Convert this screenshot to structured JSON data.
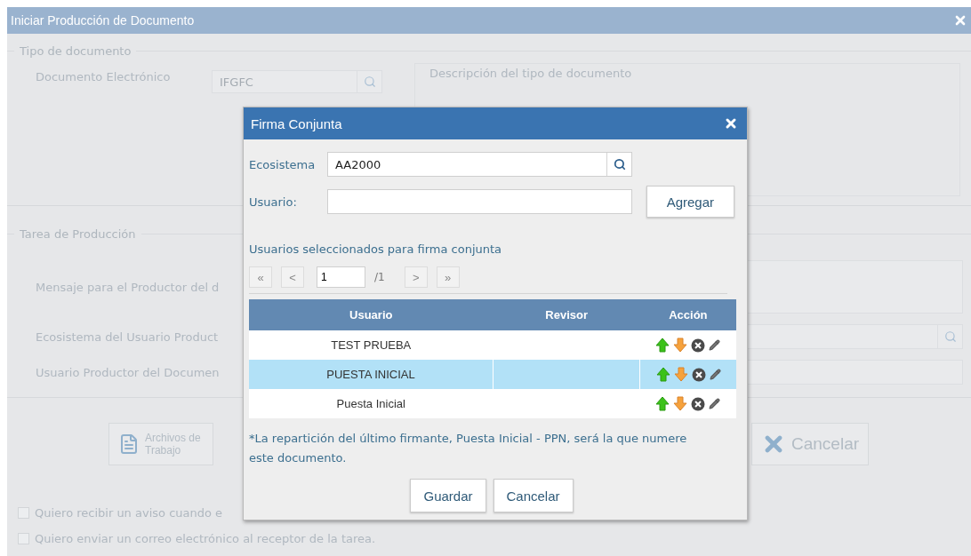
{
  "window": {
    "title": "Iniciar Producción de Documento"
  },
  "document_type": {
    "legend": "Tipo de documento",
    "label": "Documento Electrónico",
    "value": "IFGFC",
    "description_legend": "Descripción del tipo de documento"
  },
  "production_task": {
    "legend": "Tarea de Producción",
    "fields": [
      {
        "label": "Mensaje para el Productor del d",
        "kind": "textarea"
      },
      {
        "label": "Ecosistema del Usuario Product",
        "kind": "search"
      },
      {
        "label": "Usuario Productor del Documen",
        "kind": "text"
      }
    ]
  },
  "actions": [
    {
      "label": "Archivos de Trabajo",
      "kind": "files"
    },
    {
      "label": "Cancelar",
      "kind": "cancel"
    }
  ],
  "options": [
    {
      "label": "Quiero recibir un aviso cuando e",
      "checked": false
    },
    {
      "label": "Quiero enviar un correo electrónico al receptor de la tarea.",
      "checked": false
    }
  ],
  "dialog": {
    "title": "Firma Conjunta",
    "ecosistema_label": "Ecosistema",
    "ecosistema_value": "AA2000",
    "usuario_label": "Usuario:",
    "add_button": "Agregar",
    "list_title": "Usuarios seleccionados para firma conjunta",
    "pager": {
      "first": "«",
      "prev": "<",
      "page": "1",
      "total": "/1",
      "next": ">",
      "last": "»"
    },
    "table": {
      "columns": [
        "Usuario",
        "Revisor",
        "Acción"
      ],
      "rows": [
        {
          "usuario": "TEST PRUEBA",
          "selected": false
        },
        {
          "usuario": "PUESTA INICIAL",
          "selected": true
        },
        {
          "usuario": "Puesta Inicial",
          "selected": false
        }
      ]
    },
    "note": "*La repartición del último firmante, Puesta Inicial - PPN, será la que numere este documento.",
    "buttons": [
      "Guardar",
      "Cancelar"
    ]
  }
}
